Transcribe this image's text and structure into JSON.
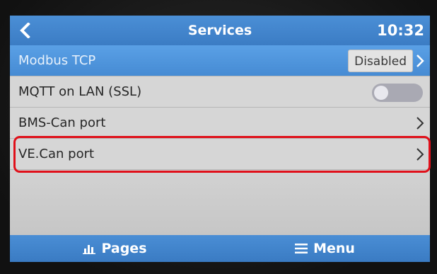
{
  "header": {
    "title": "Services",
    "clock": "10:32"
  },
  "rows": [
    {
      "label": "Modbus TCP",
      "value": "Disabled",
      "selected": true
    },
    {
      "label": "MQTT on LAN (SSL)",
      "toggle_on": false
    },
    {
      "label": "BMS-Can port"
    },
    {
      "label": "VE.Can port",
      "highlighted": true
    }
  ],
  "footer": {
    "pages_label": "Pages",
    "menu_label": "Menu"
  },
  "colors": {
    "header_blue": "#3b7cc4",
    "selection_blue": "#468bd3",
    "highlight_red": "#e0101a"
  }
}
